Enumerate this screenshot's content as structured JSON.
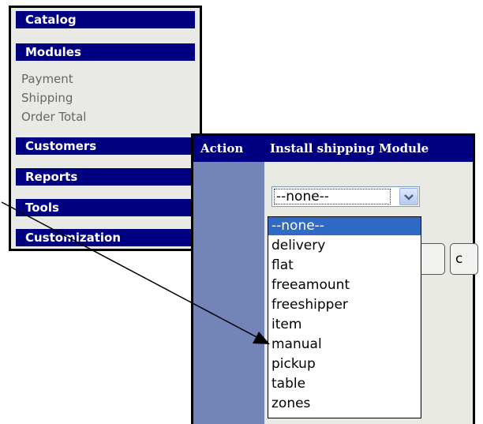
{
  "menu": {
    "catalog": "Catalog",
    "modules": "Modules",
    "modules_submenu": [
      "Payment",
      "Shipping",
      "Order Total"
    ],
    "customers": "Customers",
    "reports": "Reports",
    "tools": "Tools",
    "customization": "Customization"
  },
  "install_panel": {
    "header_action": "Action",
    "header_title": "Install shipping Module",
    "select_value": "--none--",
    "button_partial_label": "c"
  },
  "dropdown": {
    "options": [
      "--none--",
      "delivery",
      "flat",
      "freeamount",
      "freeshipper",
      "item",
      "manual",
      "pickup",
      "table",
      "zones"
    ],
    "selected_index": 0
  },
  "colors": {
    "menu_header_bg": "#000080",
    "panel_bg": "#7284b8",
    "selected_option_bg": "#316ac5"
  }
}
